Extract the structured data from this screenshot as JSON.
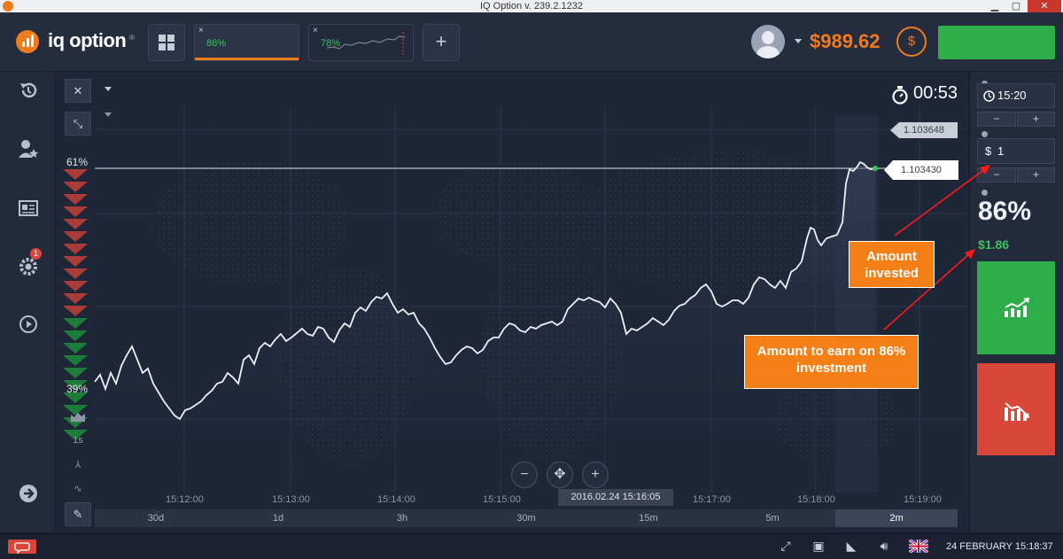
{
  "window": {
    "title": "IQ Option v. 239.2.1232",
    "min": "▁",
    "max": "▢",
    "close": "✕"
  },
  "header": {
    "logo_text": "iq option",
    "logo_reg": "®",
    "tabs": [
      {
        "close": "×",
        "percent": "86%"
      },
      {
        "close": "×",
        "percent": "78%"
      }
    ],
    "add_tab": "+",
    "balance": "$989.62",
    "refill_icon": "$"
  },
  "sidebar": {
    "notification_count": "1"
  },
  "chart": {
    "timer": "00:53",
    "price_upper": "1.103648",
    "price_current": "1.103430",
    "pct_top": "61%",
    "pct_bottom": "39%",
    "time_ticks": [
      "15:12:00",
      "15:13:00",
      "15:14:00",
      "15:15:00",
      "15:16:00",
      "15:17:00",
      "15:18:00",
      "15:19:00"
    ],
    "selected_time": "2016.02.24 15:16:05",
    "periods": [
      "30d",
      "1d",
      "3h",
      "30m",
      "15m",
      "5m",
      "2m"
    ],
    "active_period": "2m",
    "zoom_out": "−",
    "zoom_in": "+",
    "mini_tools": {
      "interval": "1s"
    }
  },
  "right_panel": {
    "expiry": "15:20",
    "amount_currency": "$",
    "amount": "1",
    "minus": "−",
    "plus": "+",
    "payout_percent": "86%",
    "profit": "$1.86"
  },
  "annotations": {
    "amount_invested": "Amount invested",
    "amount_to_earn": "Amount to earn on 86% investment"
  },
  "statusbar": {
    "datetime": "24 FEBRUARY 15:18:37"
  },
  "colors": {
    "accent": "#f07b1c",
    "call": "#2eae48",
    "put": "#d9473a",
    "profit": "#3cc25c"
  }
}
